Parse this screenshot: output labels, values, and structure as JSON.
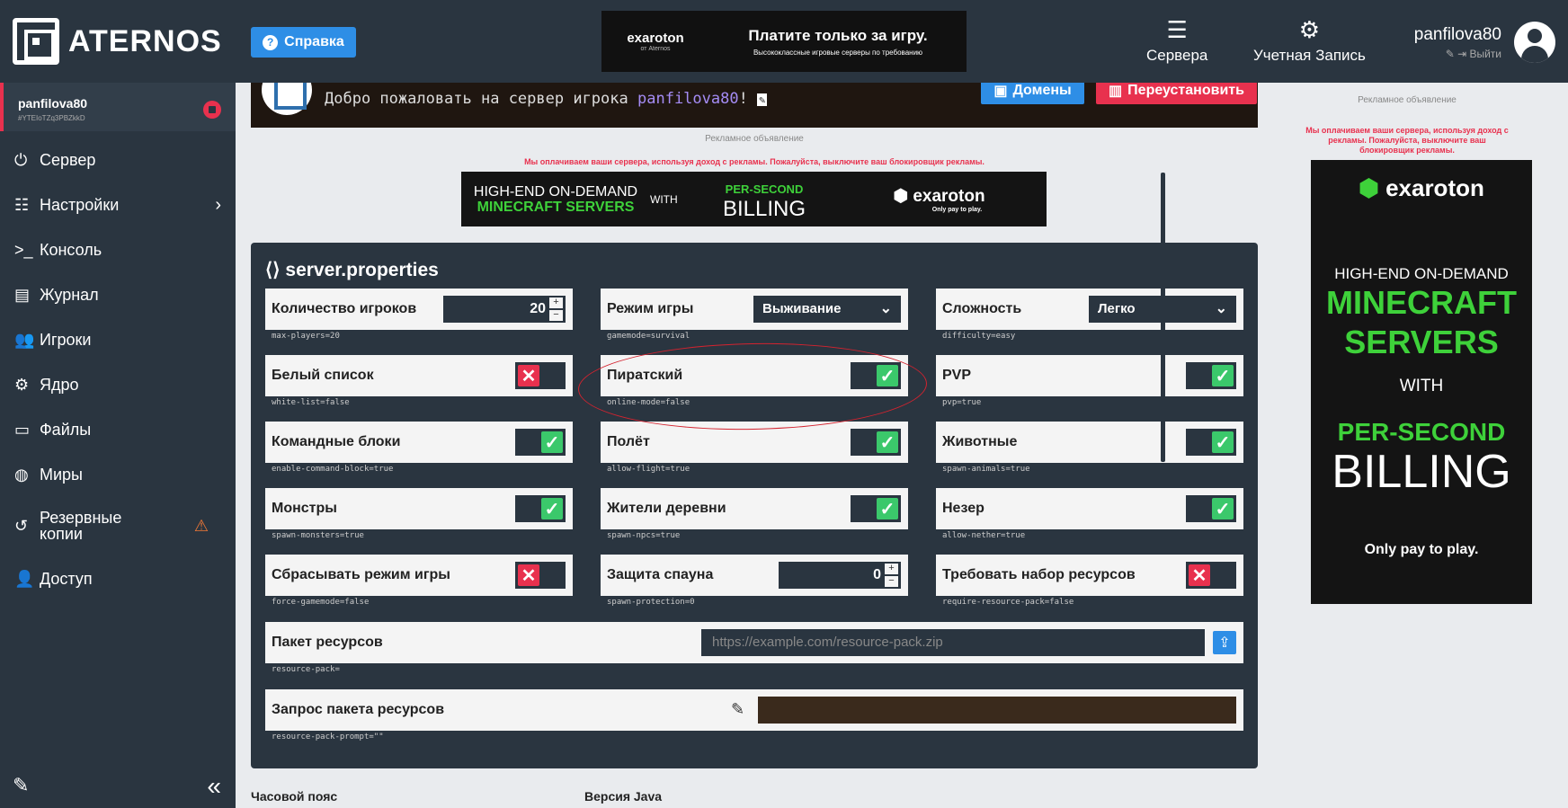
{
  "header": {
    "logo_text": "ATERNOS",
    "help_label": "Справка",
    "ad": {
      "brand": "exaroton",
      "brand_sub": "от Aternos",
      "headline": "Платите только за игру.",
      "subline": "Высококлассные игровые серверы по требованию"
    },
    "nav_servers": "Сервера",
    "nav_account": "Учетная Запись",
    "username": "panfilova80",
    "logout": "Выйти"
  },
  "sidebar": {
    "server_name": "panfilova80",
    "server_id": "#YTEIoTZq3PBZkkD",
    "items": [
      {
        "label": "Сервер",
        "icon": "power-icon"
      },
      {
        "label": "Настройки",
        "icon": "sliders-icon"
      },
      {
        "label": "Консоль",
        "icon": "terminal-icon"
      },
      {
        "label": "Журнал",
        "icon": "file-icon"
      },
      {
        "label": "Игроки",
        "icon": "users-icon"
      },
      {
        "label": "Ядро",
        "icon": "gears-icon"
      },
      {
        "label": "Файлы",
        "icon": "folder-icon"
      },
      {
        "label": "Миры",
        "icon": "globe-icon"
      },
      {
        "label": "Резервные копии",
        "icon": "history-icon"
      },
      {
        "label": "Доступ",
        "icon": "user-lock-icon"
      }
    ]
  },
  "main": {
    "welcome_prefix": "Добро пожаловать на сервер игрока ",
    "welcome_name": "panfilova80",
    "welcome_suffix": "!",
    "domains_label": "Домены",
    "reinstall_label": "Переустановить",
    "ad_label": "Рекламное объявление",
    "ad_warning": "Мы оплачиваем ваши сервера, используя доход с рекламы. Пожалуйста, выключите ваш блокировщик рекламы.",
    "mid_ad": {
      "line1": "HIGH-END ON-DEMAND",
      "line2": "MINECRAFT SERVERS",
      "with": "WITH",
      "per_second": "PER-SECOND",
      "billing": "BILLING",
      "brand": "exaroton",
      "tagline": "Only pay to play."
    },
    "props_title": "server.properties",
    "props": {
      "max_players": {
        "label": "Количество игроков",
        "key": "max-players=20",
        "value": "20"
      },
      "gamemode": {
        "label": "Режим игры",
        "key": "gamemode=survival",
        "value": "Выживание"
      },
      "difficulty": {
        "label": "Сложность",
        "key": "difficulty=easy",
        "value": "Легко"
      },
      "whitelist": {
        "label": "Белый список",
        "key": "white-list=false",
        "on": false
      },
      "online_mode": {
        "label": "Пиратский",
        "key": "online-mode=false",
        "on": true
      },
      "pvp": {
        "label": "PVP",
        "key": "pvp=true",
        "on": true
      },
      "command_blocks": {
        "label": "Командные блоки",
        "key": "enable-command-block=true",
        "on": true
      },
      "flight": {
        "label": "Полёт",
        "key": "allow-flight=true",
        "on": true
      },
      "animals": {
        "label": "Животные",
        "key": "spawn-animals=true",
        "on": true
      },
      "monsters": {
        "label": "Монстры",
        "key": "spawn-monsters=true",
        "on": true
      },
      "npcs": {
        "label": "Жители деревни",
        "key": "spawn-npcs=true",
        "on": true
      },
      "nether": {
        "label": "Незер",
        "key": "allow-nether=true",
        "on": true
      },
      "force_gamemode": {
        "label": "Сбрасывать режим игры",
        "key": "force-gamemode=false",
        "on": false
      },
      "spawn_protection": {
        "label": "Защита спауна",
        "key": "spawn-protection=0",
        "value": "0"
      },
      "require_pack": {
        "label": "Требовать набор ресурсов",
        "key": "require-resource-pack=false",
        "on": false
      },
      "resource_pack": {
        "label": "Пакет ресурсов",
        "key": "resource-pack=",
        "placeholder": "https://example.com/resource-pack.zip"
      },
      "resource_pack_prompt": {
        "label": "Запрос пакета ресурсов",
        "key": "resource-pack-prompt=\"\""
      }
    },
    "timezone_label": "Часовой пояс",
    "java_label": "Версия Java"
  },
  "right_ad": {
    "label": "Рекламное объявление",
    "warning": "Мы оплачиваем ваши сервера, используя доход с рекламы. Пожалуйста, выключите ваш блокировщик рекламы.",
    "brand": "exaroton",
    "line1": "HIGH-END ON-DEMAND",
    "line2": "MINECRAFT",
    "line3": "SERVERS",
    "with": "WITH",
    "per_second": "PER-SECOND",
    "billing": "BILLING",
    "tagline": "Only pay to play."
  },
  "colors": {
    "accent_blue": "#2e8ee6",
    "danger_red": "#e8314e",
    "toggle_green": "#3bc86b",
    "dark_panel": "#2a3540"
  }
}
